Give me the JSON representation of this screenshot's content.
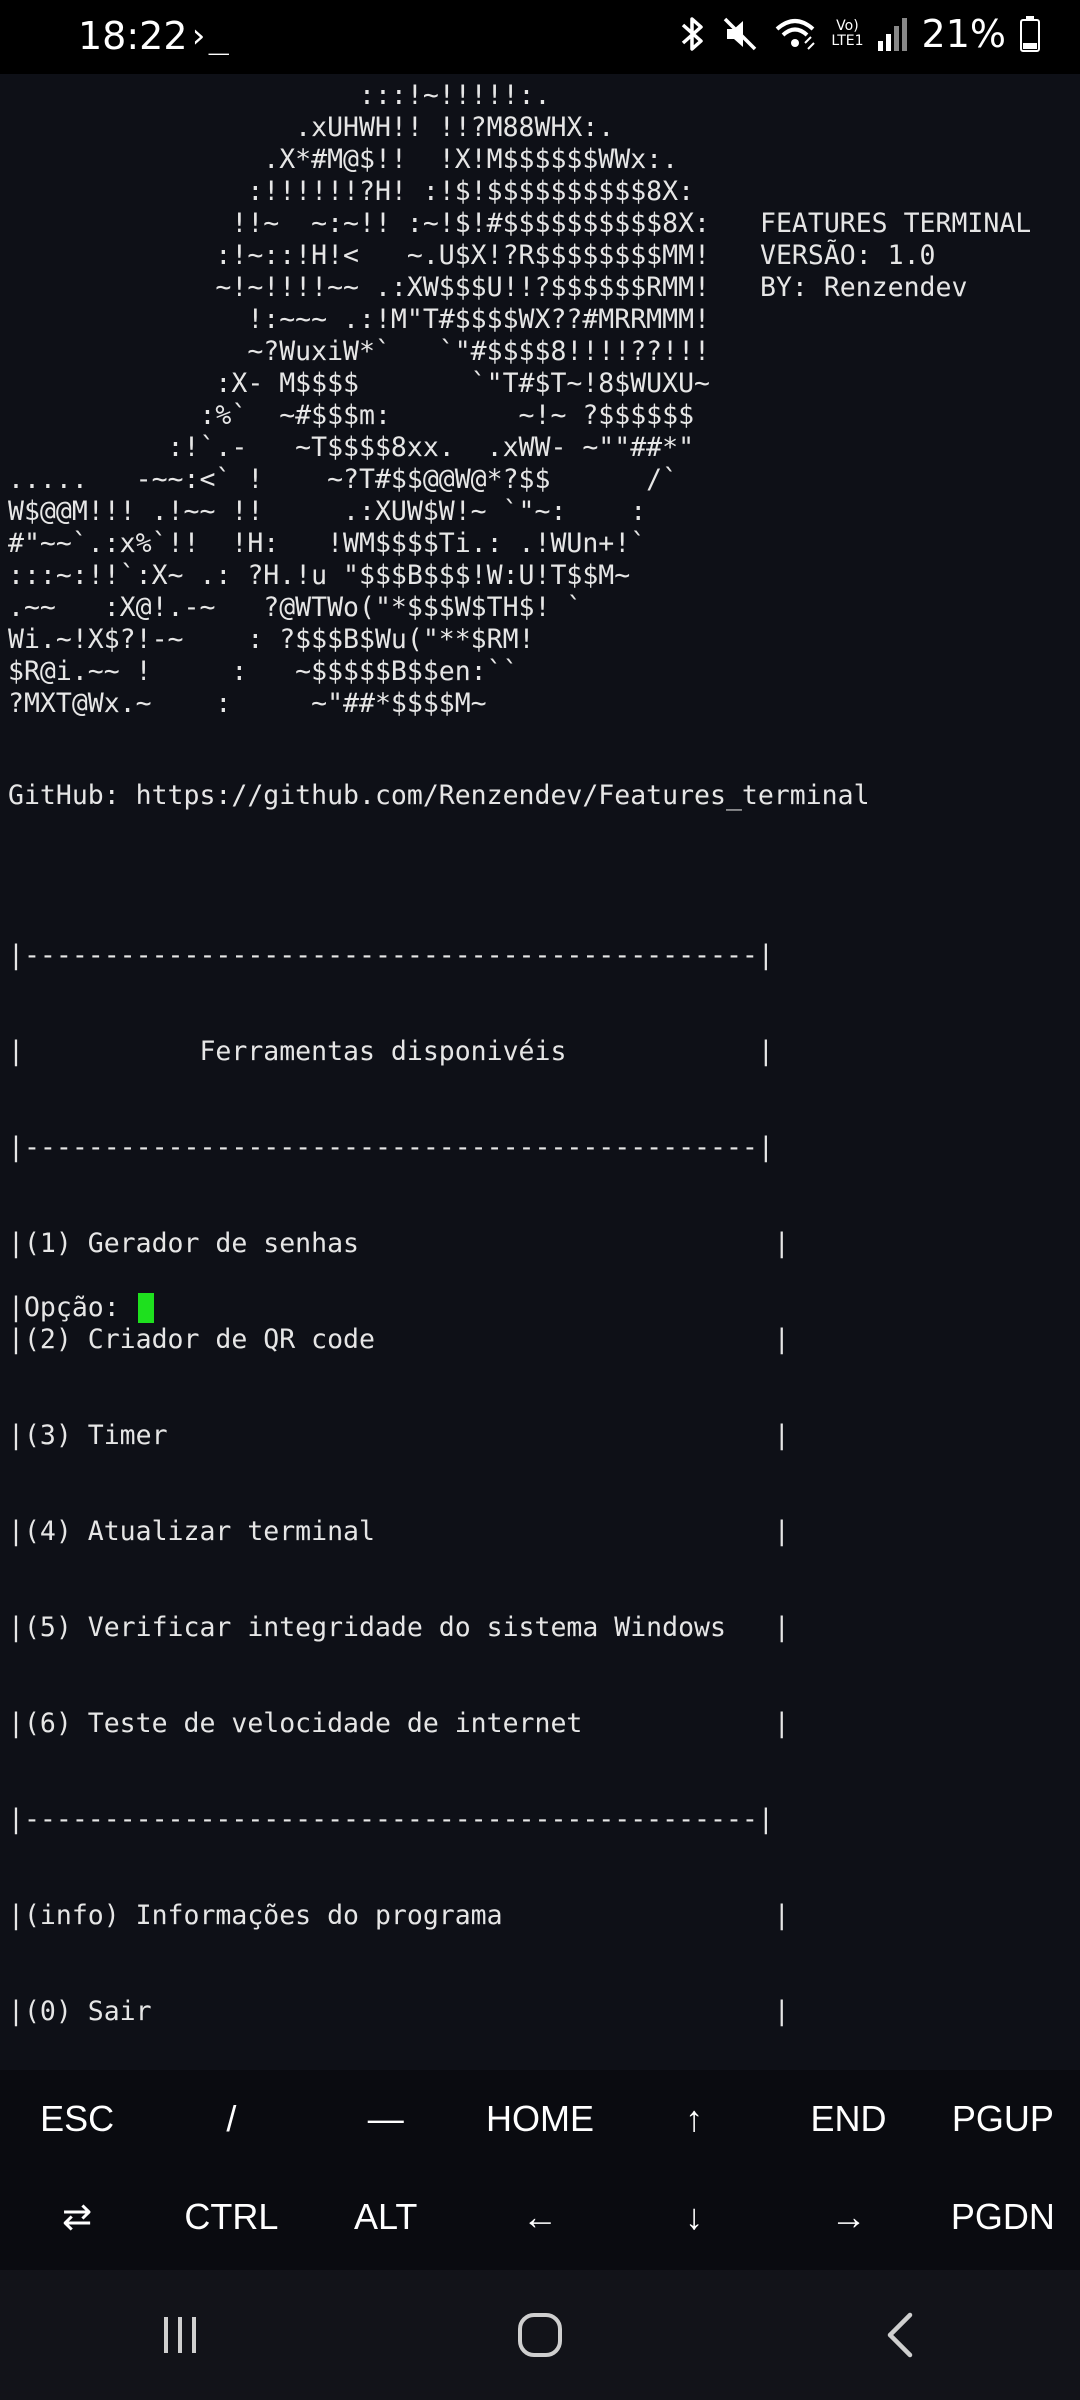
{
  "status_bar": {
    "time": "18:22",
    "terminal_icon": "›_",
    "signal_label": "Vo)\nLTE1",
    "battery": "21%",
    "icons": [
      "bluetooth-icon",
      "mute-icon",
      "wifi-icon",
      "signal-icon",
      "battery-icon"
    ]
  },
  "terminal": {
    "ascii_art": "                      :::!~!!!!!:.\n                  .xUHWH!! !!?M88WHX:.\n                .X*#M@$!!  !X!M$$$$$$WWx:.\n               :!!!!!!?H! :!$!$$$$$$$$$$8X:\n              !!~  ~:~!! :~!$!#$$$$$$$$$$8X:\n             :!~::!H!<   ~.U$X!?R$$$$$$$$MM!\n             ~!~!!!!~~ .:XW$$$U!!?$$$$$$RMM!\n               !:~~~ .:!M\"T#$$$$WX??#MRRMMM!\n               ~?WuxiW*`   `\"#$$$$8!!!!??!!!\n             :X- M$$$$       `\"T#$T~!8$WUXU~\n            :%`  ~#$$$m:        ~!~ ?$$$$$$\n          :!`.-   ~T$$$$8xx.  .xWW- ~\"\"##*\"\n.....   -~~:<` !    ~?T#$$@@W@*?$$      /`\nW$@@M!!! .!~~ !!     .:XUW$W!~ `\"~:    :\n#\"~~`.:x%`!!  !H:   !WM$$$$Ti.: .!WUn+!`\n:::~:!!`:X~ .: ?H.!u \"$$$B$$$!W:U!T$$M~\n.~~   :X@!.-~   ?@WTWo(\"*$$$W$TH$! `\nWi.~!X$?!-~    : ?$$$B$Wu(\"**$RM!\n$R@i.~~ !     :   ~$$$$$B$$en:``\n?MXT@Wx.~    :     ~\"##*$$$$M~",
    "features_info": "FEATURES TERMINAL\nVERSÃO: 1.0\nBY: Renzendev",
    "github_line": "GitHub: https://github.com/Renzendev/Features_terminal",
    "menu": {
      "separator": "|----------------------------------------------|",
      "title_line": "|           Ferramentas disponivéis            |",
      "items": [
        "|(1) Gerador de senhas                          |",
        "|(2) Criador de QR code                         |",
        "|(3) Timer                                      |",
        "|(4) Atualizar terminal                         |",
        "|(5) Verificar integridade do sistema Windows   |",
        "|(6) Teste de velocidade de internet            |"
      ],
      "extra_items": [
        "|(info) Informações do programa                 |",
        "|(0) Sair                                       |"
      ]
    },
    "prompt": "|Opção: "
  },
  "extra_keys": {
    "row1": [
      "ESC",
      "/",
      "—",
      "HOME",
      "↑",
      "END",
      "PGUP"
    ],
    "row2": [
      "⇄",
      "CTRL",
      "ALT",
      "←",
      "↓",
      "→",
      "PGDN"
    ]
  },
  "nav_bar": {
    "buttons": [
      "recent-apps-icon",
      "home-icon",
      "back-icon"
    ]
  }
}
